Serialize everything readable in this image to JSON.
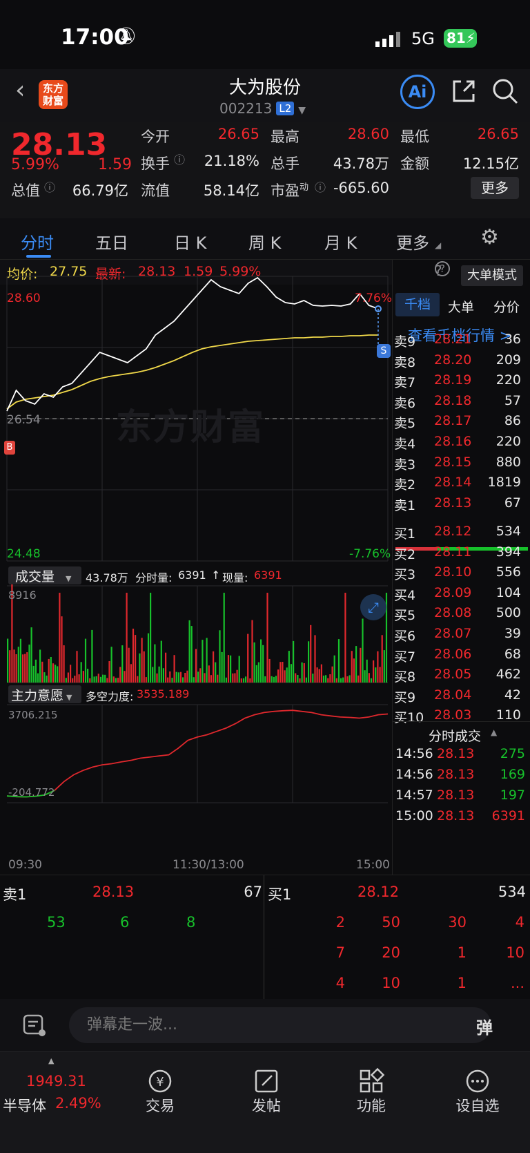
{
  "status": {
    "time": "17:00",
    "network": "5G",
    "battery": "81"
  },
  "header": {
    "stock_name": "大为股份",
    "stock_code": "002213",
    "level_badge": "L2",
    "logo_text_1": "东方",
    "logo_text_2": "财富"
  },
  "quote": {
    "price": "28.13",
    "change_pct": "5.99%",
    "change": "1.59",
    "open_label": "今开",
    "open": "26.65",
    "high_label": "最高",
    "high": "28.60",
    "low_label": "最低",
    "low": "26.65",
    "turnover_label": "换手",
    "turnover": "21.18%",
    "volume_label": "总手",
    "volume": "43.78万",
    "amount_label": "金额",
    "amount": "12.15亿",
    "mcap_label": "总值",
    "mcap": "66.79亿",
    "float_label": "流值",
    "float_cap": "58.14亿",
    "pe_label": "市盈",
    "pe_sup": "动",
    "pe": "-665.60",
    "more_button": "更多"
  },
  "tabs": [
    "分时",
    "五日",
    "日 K",
    "周 K",
    "月 K",
    "更多"
  ],
  "chart_info": {
    "avg_label": "均价:",
    "avg": "27.75",
    "latest_label": "最新:",
    "latest": "28.13",
    "latest_change": "1.59",
    "latest_pct": "5.99%",
    "big_order_button": "大单模式"
  },
  "main_chart": {
    "top_price": "28.60",
    "bottom_price": "24.48",
    "top_pct": "7.76%",
    "bottom_pct": "-7.76%",
    "prev_close": "26.54",
    "watermark": "东方财富",
    "buy_marker": "B",
    "sell_marker": "S"
  },
  "volume_panel": {
    "selector": "成交量",
    "total": "43.78万",
    "minute_label": "分时量:",
    "minute_value": "6391",
    "arrow": "↑",
    "now_label": "现量:",
    "now_value": "6391",
    "max": "8916"
  },
  "force_panel": {
    "selector": "主力意愿",
    "label": "多空力度:",
    "value": "3535.189",
    "top": "3706.215",
    "bottom": "-204.772"
  },
  "time_axis": [
    "09:30",
    "11:30/13:00",
    "15:00"
  ],
  "side_tabs": [
    "千档",
    "大单",
    "分价"
  ],
  "side_link": "查看千档行情 >",
  "asks": [
    {
      "label": "卖9",
      "price": "28.21",
      "vol": "36"
    },
    {
      "label": "卖8",
      "price": "28.20",
      "vol": "209"
    },
    {
      "label": "卖7",
      "price": "28.19",
      "vol": "220"
    },
    {
      "label": "卖6",
      "price": "28.18",
      "vol": "57"
    },
    {
      "label": "卖5",
      "price": "28.17",
      "vol": "86"
    },
    {
      "label": "卖4",
      "price": "28.16",
      "vol": "220"
    },
    {
      "label": "卖3",
      "price": "28.15",
      "vol": "880"
    },
    {
      "label": "卖2",
      "price": "28.14",
      "vol": "1819"
    },
    {
      "label": "卖1",
      "price": "28.13",
      "vol": "67"
    }
  ],
  "bids": [
    {
      "label": "买1",
      "price": "28.12",
      "vol": "534"
    },
    {
      "label": "买2",
      "price": "28.11",
      "vol": "394"
    },
    {
      "label": "买3",
      "price": "28.10",
      "vol": "556"
    },
    {
      "label": "买4",
      "price": "28.09",
      "vol": "104"
    },
    {
      "label": "买5",
      "price": "28.08",
      "vol": "500"
    },
    {
      "label": "买6",
      "price": "28.07",
      "vol": "39"
    },
    {
      "label": "买7",
      "price": "28.06",
      "vol": "68"
    },
    {
      "label": "买8",
      "price": "28.05",
      "vol": "462"
    },
    {
      "label": "买9",
      "price": "28.04",
      "vol": "42"
    },
    {
      "label": "买10",
      "price": "28.03",
      "vol": "110"
    }
  ],
  "ticks_title": "分时成交",
  "ticks": [
    {
      "time": "14:56",
      "price": "28.13",
      "vol": "275"
    },
    {
      "time": "14:56",
      "price": "28.13",
      "vol": "169"
    },
    {
      "time": "14:57",
      "price": "28.13",
      "vol": "197"
    },
    {
      "time": "15:00",
      "price": "28.13",
      "vol": "6391"
    }
  ],
  "summary": {
    "sell_label": "卖1",
    "sell_price": "28.13",
    "sell_vol": "67",
    "buy_label": "买1",
    "buy_price": "28.12",
    "buy_vol": "534",
    "sell_queue": [
      "53",
      "6",
      "8"
    ],
    "buy_queue": [
      [
        "2",
        "50",
        "30",
        "4"
      ],
      [
        "7",
        "20",
        "1",
        "10"
      ],
      [
        "4",
        "10",
        "1",
        "..."
      ]
    ]
  },
  "danmu": {
    "placeholder": "弹幕走一波..."
  },
  "bottom_nav": {
    "index_value": "1949.31",
    "index_name": "半导体",
    "index_pct": "2.49%",
    "items": [
      "交易",
      "发帖",
      "功能",
      "设自选"
    ]
  },
  "chart_data": {
    "type": "line",
    "x_range": [
      "09:30",
      "15:00"
    ],
    "ylim": [
      24.48,
      28.6
    ],
    "prev_close": 26.54,
    "series": [
      {
        "name": "最新",
        "values": [
          26.65,
          26.95,
          26.8,
          26.75,
          26.9,
          26.85,
          27.0,
          27.05,
          27.2,
          27.35,
          27.5,
          27.45,
          27.4,
          27.35,
          27.45,
          27.55,
          27.75,
          27.85,
          27.95,
          28.1,
          28.25,
          28.4,
          28.55,
          28.45,
          28.4,
          28.35,
          28.5,
          28.58,
          28.45,
          28.3,
          28.22,
          28.2,
          28.25,
          28.18,
          28.17,
          28.18,
          28.17,
          28.2,
          28.35,
          28.18,
          28.13
        ]
      },
      {
        "name": "均价",
        "values": [
          26.68,
          26.78,
          26.82,
          26.84,
          26.86,
          26.88,
          26.92,
          26.96,
          27.02,
          27.08,
          27.12,
          27.15,
          27.17,
          27.19,
          27.21,
          27.24,
          27.28,
          27.33,
          27.38,
          27.44,
          27.5,
          27.55,
          27.58,
          27.6,
          27.62,
          27.64,
          27.66,
          27.67,
          27.68,
          27.69,
          27.7,
          27.71,
          27.71,
          27.72,
          27.72,
          27.73,
          27.73,
          27.74,
          27.74,
          27.75,
          27.75
        ]
      }
    ],
    "volume_max": 8916,
    "force_range": [
      -204.772,
      3706.215
    ]
  }
}
